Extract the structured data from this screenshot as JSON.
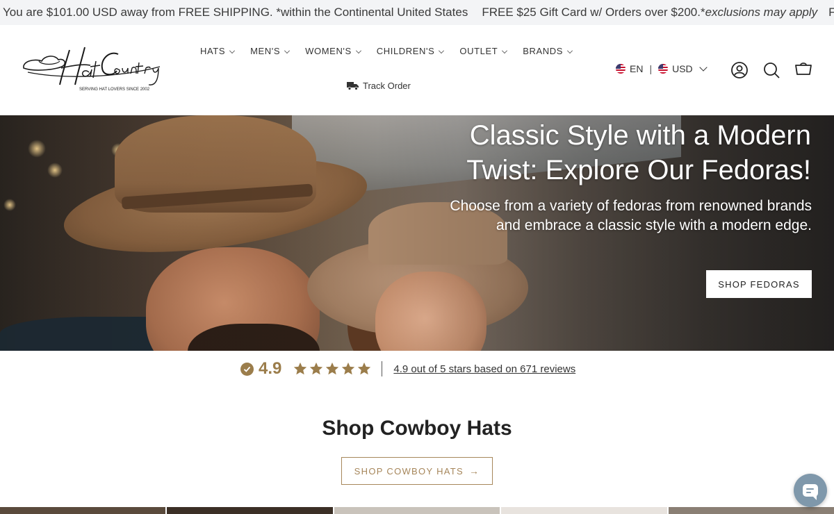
{
  "announcement": {
    "shipping_message": "You are $101.00 USD away from FREE SHIPPING. *within the Continental United States",
    "gift_message_main": "FREE $25 Gift Card w/ Orders over $200.*",
    "gift_message_note": "exclusions may apply",
    "tail": "F"
  },
  "logo": {
    "name": "Hat Country",
    "tagline": "SERVING HAT LOVERS SINCE 2002"
  },
  "nav": {
    "items": [
      {
        "label": "HATS"
      },
      {
        "label": "MEN'S"
      },
      {
        "label": "WOMEN'S"
      },
      {
        "label": "CHILDREN'S"
      },
      {
        "label": "OUTLET"
      },
      {
        "label": "BRANDS"
      }
    ],
    "track_order": "Track Order"
  },
  "locale": {
    "language": "EN",
    "currency": "USD"
  },
  "hero": {
    "title": "Classic Style with a Modern Twist: Explore Our Fedoras!",
    "subtitle": "Choose from a variety of fedoras from renowned brands and embrace a classic style with a modern edge.",
    "button_label": "SHOP FEDORAS"
  },
  "reviews": {
    "score": "4.9",
    "summary": "4.9 out of 5 stars based on 671 reviews",
    "stars": 5
  },
  "section": {
    "title": "Shop Cowboy Hats",
    "button_label": "SHOP COWBOY HATS",
    "button_arrow": "→"
  },
  "colors": {
    "accent_gold": "#9b7d4b",
    "announcement_bg": "#f3f4f6",
    "chat_bg": "#7f98ab"
  }
}
